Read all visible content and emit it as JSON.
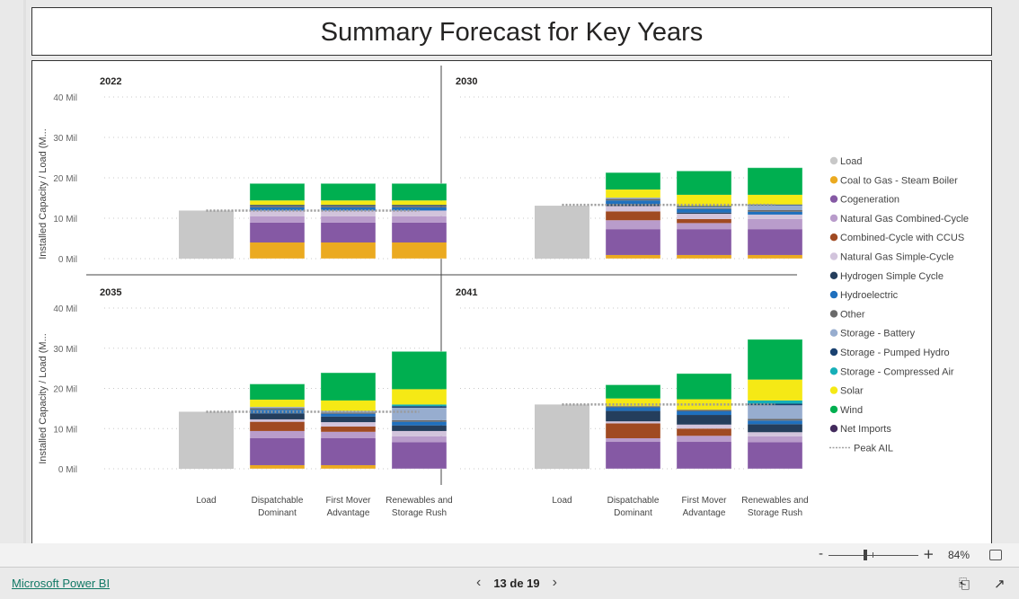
{
  "title": "Summary Forecast for Key Years",
  "footer": {
    "brand_link": "Microsoft Power BI",
    "page_indicator": "13 de 19",
    "prev_icon": "chevron-left-icon",
    "next_icon": "chevron-right-icon",
    "share_icon": "share-icon",
    "fullscreen_icon": "expand-icon"
  },
  "zoom": {
    "minus": "-",
    "plus": "+",
    "level": "84%",
    "fit_icon": "fit-to-page-icon"
  },
  "chart_data": {
    "type": "bar",
    "stacked": true,
    "title": "Summary Forecast for Key Years",
    "ylabel": "Installed Capacity / Load (M...",
    "ylim": [
      0,
      40
    ],
    "yticks": [
      "0 Mil",
      "10 Mil",
      "20 Mil",
      "30 Mil",
      "40 Mil"
    ],
    "ytick_values": [
      0,
      10,
      20,
      30,
      40
    ],
    "grid": true,
    "legend_position": "right",
    "categories": [
      "Load",
      "Dispatchable Dominant",
      "First Mover Advantage",
      "Renewables and Storage Rush"
    ],
    "category_labels": [
      [
        "Load"
      ],
      [
        "Dispatchable",
        "Dominant"
      ],
      [
        "First Mover",
        "Advantage"
      ],
      [
        "Renewables and",
        "Storage Rush"
      ]
    ],
    "series": [
      {
        "name": "Load",
        "color": "#C8C8C8"
      },
      {
        "name": "Coal to Gas - Steam Boiler",
        "color": "#EBAA20"
      },
      {
        "name": "Cogeneration",
        "color": "#8559A4"
      },
      {
        "name": "Natural Gas Combined-Cycle",
        "color": "#B99CCB"
      },
      {
        "name": "Combined-Cycle with CCUS",
        "color": "#A04A22"
      },
      {
        "name": "Natural Gas Simple-Cycle",
        "color": "#D2C4DC"
      },
      {
        "name": "Hydrogen Simple Cycle",
        "color": "#243E5C"
      },
      {
        "name": "Hydroelectric",
        "color": "#1F70BE"
      },
      {
        "name": "Other",
        "color": "#6A6A6A"
      },
      {
        "name": "Storage - Battery",
        "color": "#97ADCF"
      },
      {
        "name": "Storage - Pumped Hydro",
        "color": "#1A4170"
      },
      {
        "name": "Storage - Compressed Air",
        "color": "#16AFB8"
      },
      {
        "name": "Solar",
        "color": "#F5E915"
      },
      {
        "name": "Wind",
        "color": "#00AF50"
      },
      {
        "name": "Net Imports",
        "color": "#432B5D"
      },
      {
        "name": "Peak AIL",
        "color": "#A0A0A0",
        "style": "dotted-line"
      }
    ],
    "panels": [
      {
        "year": "2022",
        "peak_ail": 11.9,
        "load": 11.9,
        "stacks": {
          "Dispatchable Dominant": {
            "Coal to Gas - Steam Boiler": 4.0,
            "Cogeneration": 4.9,
            "Natural Gas Combined-Cycle": 1.6,
            "Natural Gas Simple-Cycle": 1.4,
            "Hydroelectric": 0.8,
            "Other": 0.4,
            "Storage - Pumped Hydro": 0.2,
            "Solar": 1.1,
            "Wind": 4.2
          },
          "First Mover Advantage": {
            "Coal to Gas - Steam Boiler": 4.0,
            "Cogeneration": 4.9,
            "Natural Gas Combined-Cycle": 1.6,
            "Natural Gas Simple-Cycle": 1.4,
            "Hydroelectric": 0.8,
            "Other": 0.4,
            "Storage - Pumped Hydro": 0.2,
            "Solar": 1.1,
            "Wind": 4.2
          },
          "Renewables and Storage Rush": {
            "Coal to Gas - Steam Boiler": 4.0,
            "Cogeneration": 4.9,
            "Natural Gas Combined-Cycle": 1.6,
            "Natural Gas Simple-Cycle": 1.4,
            "Hydroelectric": 0.8,
            "Other": 0.4,
            "Storage - Pumped Hydro": 0.2,
            "Solar": 1.1,
            "Wind": 4.2
          }
        }
      },
      {
        "year": "2030",
        "peak_ail": 13.3,
        "load": 13.1,
        "stacks": {
          "Dispatchable Dominant": {
            "Coal to Gas - Steam Boiler": 0.9,
            "Cogeneration": 6.4,
            "Natural Gas Combined-Cycle": 2.2,
            "Combined-Cycle with CCUS": 2.2,
            "Natural Gas Simple-Cycle": 1.3,
            "Hydrogen Simple Cycle": 0.5,
            "Hydroelectric": 0.9,
            "Other": 0.4,
            "Storage - Battery": 0.3,
            "Solar": 2.0,
            "Wind": 4.2
          },
          "First Mover Advantage": {
            "Coal to Gas - Steam Boiler": 0.9,
            "Cogeneration": 6.4,
            "Natural Gas Combined-Cycle": 1.5,
            "Combined-Cycle with CCUS": 1.0,
            "Natural Gas Simple-Cycle": 1.3,
            "Hydrogen Simple Cycle": 0.3,
            "Hydroelectric": 0.9,
            "Other": 0.2,
            "Storage - Battery": 0.3,
            "Storage - Pumped Hydro": 0.2,
            "Solar": 2.8,
            "Wind": 5.9
          },
          "Renewables and Storage Rush": {
            "Coal to Gas - Steam Boiler": 0.9,
            "Cogeneration": 6.4,
            "Natural Gas Combined-Cycle": 2.5,
            "Natural Gas Simple-Cycle": 1.1,
            "Hydroelectric": 0.7,
            "Other": 0.4,
            "Storage - Battery": 1.2,
            "Storage - Pumped Hydro": 0.2,
            "Solar": 2.4,
            "Wind": 6.7
          }
        }
      },
      {
        "year": "2035",
        "peak_ail": 14.2,
        "load": 14.2,
        "stacks": {
          "Dispatchable Dominant": {
            "Coal to Gas - Steam Boiler": 0.9,
            "Cogeneration": 6.7,
            "Natural Gas Combined-Cycle": 1.8,
            "Combined-Cycle with CCUS": 2.3,
            "Natural Gas Simple-Cycle": 0.6,
            "Hydrogen Simple Cycle": 1.5,
            "Hydroelectric": 0.9,
            "Other": 0.4,
            "Storage - Battery": 0.3,
            "Solar": 1.8,
            "Wind": 3.9
          },
          "First Mover Advantage": {
            "Coal to Gas - Steam Boiler": 0.9,
            "Cogeneration": 6.7,
            "Natural Gas Combined-Cycle": 1.6,
            "Combined-Cycle with CCUS": 1.3,
            "Natural Gas Simple-Cycle": 1.1,
            "Hydrogen Simple Cycle": 1.4,
            "Hydroelectric": 0.7,
            "Other": 0.3,
            "Storage - Battery": 0.4,
            "Solar": 2.6,
            "Wind": 6.9
          },
          "Renewables and Storage Rush": {
            "Cogeneration": 6.6,
            "Natural Gas Combined-Cycle": 1.5,
            "Natural Gas Simple-Cycle": 1.3,
            "Hydrogen Simple Cycle": 1.4,
            "Hydroelectric": 0.9,
            "Other": 0.4,
            "Storage - Battery": 3.1,
            "Storage - Pumped Hydro": 0.4,
            "Storage - Compressed Air": 0.4,
            "Solar": 3.8,
            "Wind": 9.4
          }
        }
      },
      {
        "year": "2041",
        "peak_ail": 16.0,
        "load": 16.0,
        "stacks": {
          "Dispatchable Dominant": {
            "Cogeneration": 6.7,
            "Natural Gas Combined-Cycle": 0.9,
            "Combined-Cycle with CCUS": 3.7,
            "Natural Gas Simple-Cycle": 0.5,
            "Hydrogen Simple Cycle": 2.6,
            "Hydroelectric": 0.9,
            "Other": 0.3,
            "Solar": 1.9,
            "Wind": 3.4
          },
          "First Mover Advantage": {
            "Cogeneration": 6.7,
            "Natural Gas Combined-Cycle": 1.5,
            "Combined-Cycle with CCUS": 1.8,
            "Natural Gas Simple-Cycle": 1.0,
            "Hydrogen Simple Cycle": 2.4,
            "Hydroelectric": 0.9,
            "Other": 0.4,
            "Solar": 2.6,
            "Wind": 6.4
          },
          "Renewables and Storage Rush": {
            "Cogeneration": 6.6,
            "Natural Gas Combined-Cycle": 1.5,
            "Natural Gas Simple-Cycle": 1.0,
            "Hydrogen Simple Cycle": 2.0,
            "Hydroelectric": 0.9,
            "Other": 0.4,
            "Storage - Battery": 3.4,
            "Storage - Pumped Hydro": 0.4,
            "Storage - Compressed Air": 0.8,
            "Solar": 5.2,
            "Wind": 10.0
          }
        }
      }
    ]
  }
}
